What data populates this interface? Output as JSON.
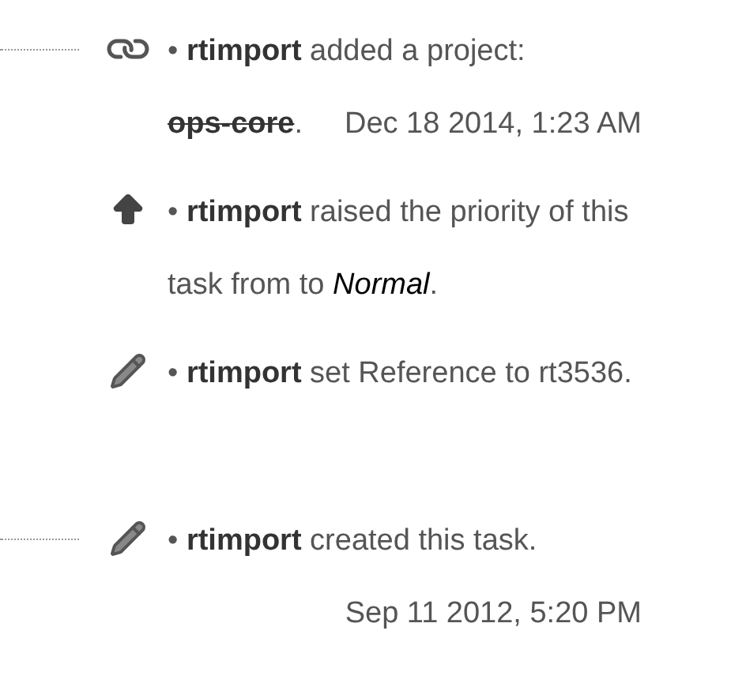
{
  "stories": [
    {
      "kind": "link",
      "connector": true,
      "text": "• **rtimport** added a project:",
      "project": {
        "name": "ops-core",
        "removed": true
      },
      "suffix": ".",
      "timestamp": "Dec 18 2014, 1:23 AM"
    },
    {
      "kind": "arrow",
      "connector": false,
      "text": "• **rtimport** raised the priority of this task from to *Normal*."
    },
    {
      "kind": "pencil",
      "connector": false,
      "text": "• **rtimport** set Reference to rt3536."
    },
    {
      "kind": "pencil",
      "connector": true,
      "text": "• **rtimport** created this task.",
      "timestamp": "Sep 11 2012, 5:20 PM"
    }
  ]
}
